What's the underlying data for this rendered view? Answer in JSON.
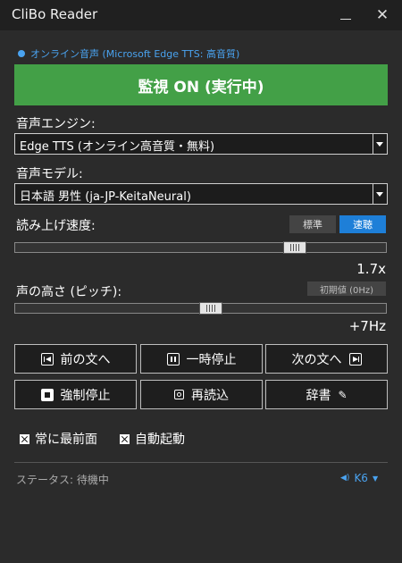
{
  "window": {
    "title": "CliBo Reader",
    "close_glyph": "✕"
  },
  "mode_line": "オンライン音声 (Microsoft Edge TTS: 高音質)",
  "monitor_button": "監視 ON (実行中)",
  "engine": {
    "label": "音声エンジン:",
    "value": "Edge TTS (オンライン高音質・無料)"
  },
  "model": {
    "label": "音声モデル:",
    "value": "日本語 男性 (ja-JP-KeitaNeural)"
  },
  "speed": {
    "label": "読み上げ速度:",
    "preset_standard": "標準",
    "preset_fast": "速聴",
    "value": "1.7x",
    "level": 0.77
  },
  "pitch": {
    "label": "声の高さ (ピッチ):",
    "reset_label": "初期値 (0Hz)",
    "value": "+7Hz",
    "level": 0.53
  },
  "buttons": {
    "prev": "前の文へ",
    "pause": "一時停止",
    "next": "次の文へ",
    "stop": "強制停止",
    "reload": "再読込",
    "dict": "辞書",
    "dict_icon_glyph": "✎"
  },
  "checkboxes": {
    "always_on_top": "常に最前面",
    "auto_start": "自動起動"
  },
  "status": {
    "text": "ステータス: 待機中",
    "hotkey": "K6",
    "speaker_glyph": "◀)",
    "caret_glyph": "▼"
  },
  "colors": {
    "accent": "#43a047",
    "link": "#4aa3f0",
    "selected": "#1e7fd8",
    "background": "#2b2b2b"
  }
}
